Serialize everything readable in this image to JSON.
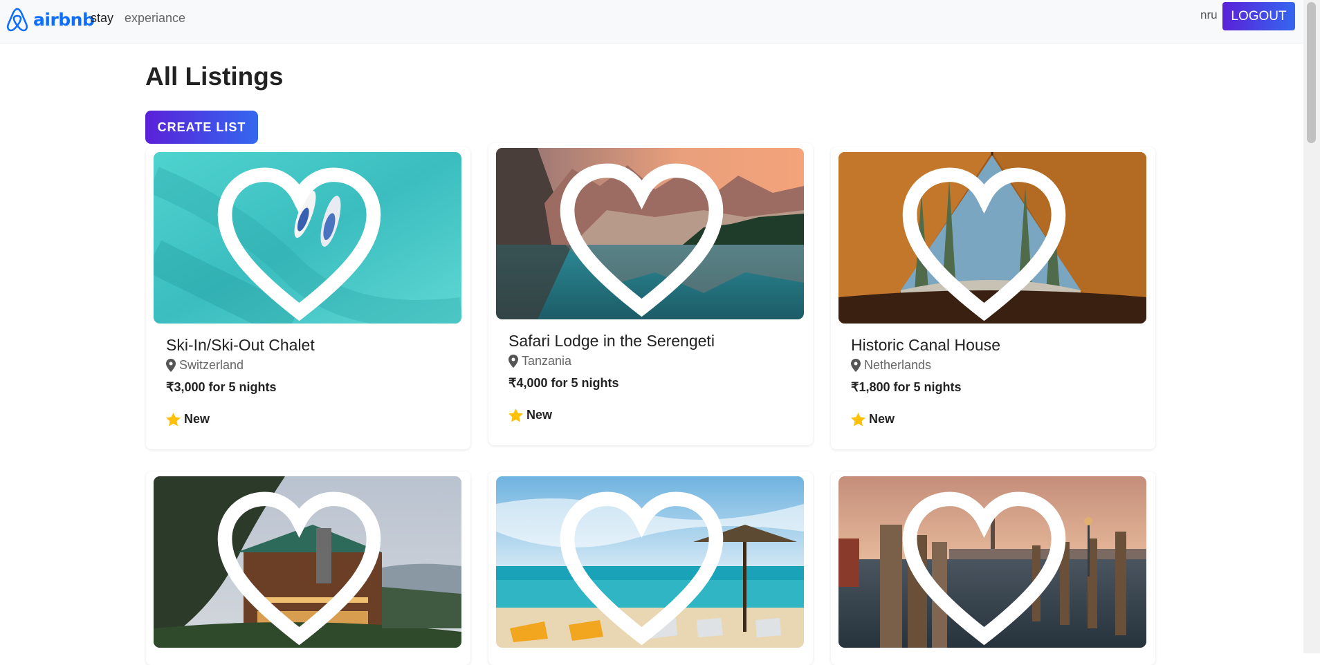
{
  "nav": {
    "brand": "airbnb",
    "links": [
      "stay",
      "experiance"
    ],
    "user": "nru",
    "logout_label": "LOGOUT"
  },
  "page": {
    "title": "All Listings",
    "create_label": "CREATE LIST"
  },
  "colors": {
    "brand": "#0d6efd",
    "button_gradient_start": "#5a21d8",
    "button_gradient_end": "#3467f0",
    "star": "#ffc107"
  },
  "listings": [
    {
      "title": "Ski-In/Ski-Out Chalet",
      "location": "Switzerland",
      "price": "₹3,000 for 5 nights",
      "rating": "New",
      "image": "turquoise-sea-with-two-paddleboards"
    },
    {
      "title": "Safari Lodge in the Serengeti",
      "location": "Tanzania",
      "price": "₹4,000 for 5 nights",
      "rating": "New",
      "image": "mountain-lake-reflection"
    },
    {
      "title": "Historic Canal House",
      "location": "Netherlands",
      "price": "₹1,800 for 5 nights",
      "rating": "New",
      "image": "forest-view-from-tent"
    },
    {
      "image": "lodge-in-forest"
    },
    {
      "image": "beach-with-straw-umbrella"
    },
    {
      "image": "venice-wooden-pier"
    }
  ]
}
